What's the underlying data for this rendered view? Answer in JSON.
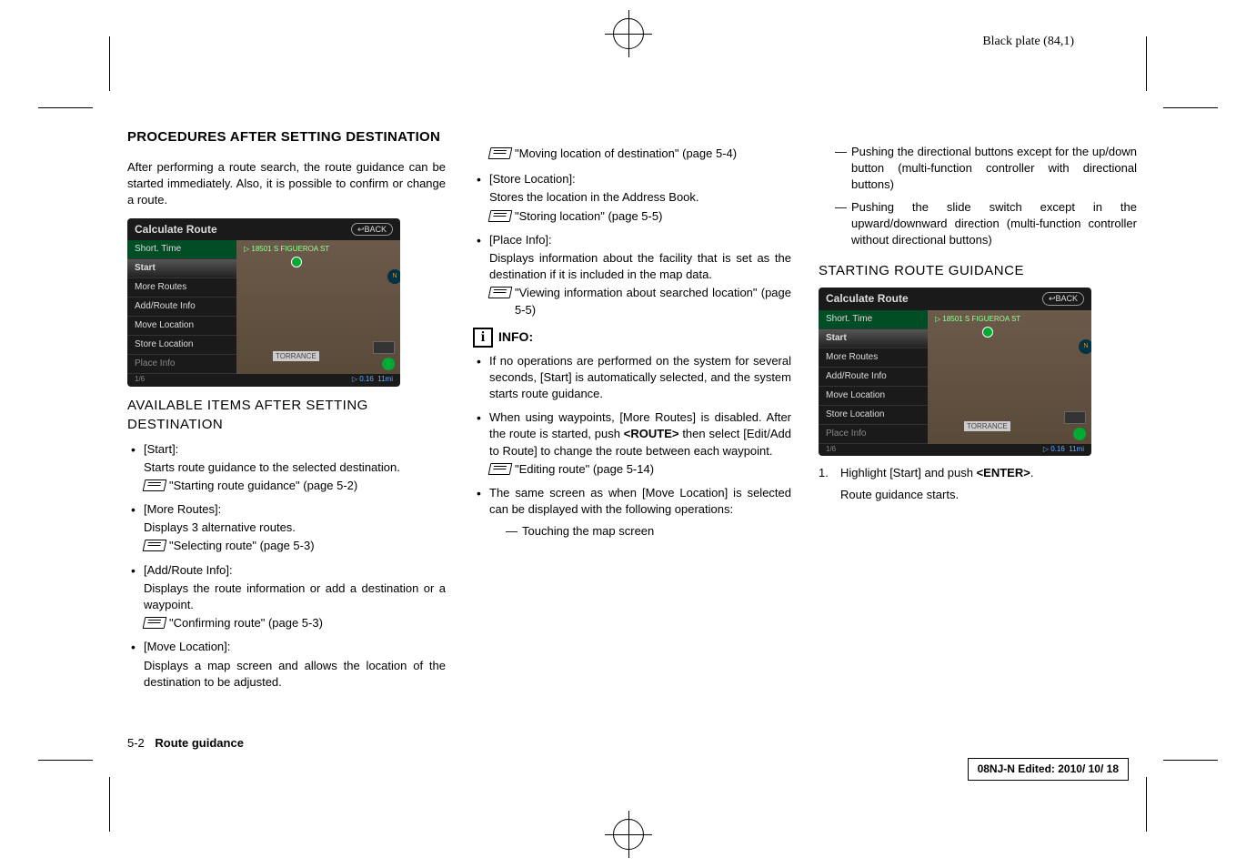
{
  "header_plate": "Black plate (84,1)",
  "title": "PROCEDURES AFTER SETTING DESTINATION",
  "intro": "After performing a route search, the route guidance can be started immediately. Also, it is possible to confirm or change a route.",
  "screenshot": {
    "title": "Calculate Route",
    "back": "BACK",
    "menu": [
      "Short. Time",
      "Start",
      "More Routes",
      "Add/Route Info",
      "Move Location",
      "Store Location",
      "Place Info"
    ],
    "address": "18501 S FIGUEROA ST",
    "city": "TORRANCE",
    "page_indicator": "1/6",
    "dist1": "0.16",
    "dist2": "11mi",
    "scale": "1mi"
  },
  "sub_heading": "AVAILABLE ITEMS AFTER SETTING DESTINATION",
  "items": [
    {
      "label": "[Start]:",
      "desc": "Starts route guidance to the selected destination.",
      "xref": "\"Starting route guidance\" (page 5-2)"
    },
    {
      "label": "[More Routes]:",
      "desc": "Displays 3 alternative routes.",
      "xref": "\"Selecting route\" (page 5-3)"
    },
    {
      "label": "[Add/Route Info]:",
      "desc": "Displays the route information or add a destination or a waypoint.",
      "xref": "\"Confirming route\" (page 5-3)"
    },
    {
      "label": "[Move Location]:",
      "desc": "Displays a map screen and allows the location of the destination to be adjusted.",
      "xref": "\"Moving location of destination\" (page 5-4)"
    },
    {
      "label": "[Store Location]:",
      "desc": "Stores the location in the Address Book.",
      "xref": "\"Storing location\" (page 5-5)"
    },
    {
      "label": "[Place Info]:",
      "desc": "Displays information about the facility that is set as the destination if it is included in the map data.",
      "xref": "\"Viewing information about searched location\" (page 5-5)"
    }
  ],
  "info_label": "INFO:",
  "info_bullets": [
    {
      "text": "If no operations are performed on the system for several seconds, [Start] is automatically selected, and the system starts route guidance."
    },
    {
      "text_pre": "When using waypoints, [More Routes] is disabled. After the route is started, push ",
      "bold": "<ROUTE>",
      "text_post": " then select [Edit/Add to Route] to change the route between each waypoint.",
      "xref": "\"Editing route\" (page 5-14)"
    },
    {
      "text": "The same screen as when [Move Location] is selected can be displayed with the following operations:",
      "dashes": [
        "Touching the map screen",
        "Pushing the directional buttons except for the up/down button (multi-function controller with directional buttons)",
        "Pushing the slide switch except in the upward/downward direction (multi-function controller without directional buttons)"
      ]
    }
  ],
  "col3_heading": "STARTING ROUTE GUIDANCE",
  "step1_pre": "Highlight [Start] and push ",
  "step1_bold": "<ENTER>",
  "step1_post": ".",
  "step1_sub": "Route guidance starts.",
  "footer_page": "5-2",
  "footer_chapter": "Route guidance",
  "doc_id": "08NJ-N Edited:  2010/ 10/ 18"
}
